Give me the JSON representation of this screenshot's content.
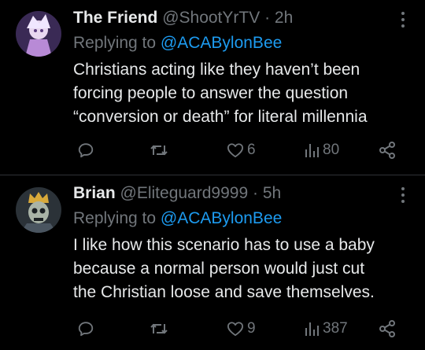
{
  "tweets": [
    {
      "display_name": "The Friend",
      "handle": "@ShootYrTV",
      "separator": "·",
      "time": "2h",
      "replying_to_prefix": "Replying to ",
      "replying_to_handle": "@ACABylonBee",
      "text_lines": [
        "Christians acting like they haven’t been",
        "forcing people to answer the question",
        "“conversion or death” for literal millennia"
      ],
      "likes": "6",
      "views": "80",
      "avatar_icon": "anime-character-avatar"
    },
    {
      "display_name": "Brian",
      "handle": "@Eliteguard9999",
      "separator": "·",
      "time": "5h",
      "replying_to_prefix": "Replying to ",
      "replying_to_handle": "@ACABylonBee",
      "text_lines": [
        "I like how this scenario has to use a baby",
        "because a normal person would just cut",
        "the Christian loose and save themselves."
      ],
      "likes": "9",
      "views": "387",
      "avatar_icon": "crowned-skeleton-avatar"
    }
  ],
  "icons": {
    "reply": "reply-icon",
    "retweet": "retweet-icon",
    "like": "heart-icon",
    "views": "views-chart-icon",
    "share": "share-icon",
    "more": "more-dots-icon"
  },
  "colors": {
    "background": "#000000",
    "text": "#e7e9ea",
    "secondary": "#71767b",
    "mention": "#1d9bf0",
    "divider": "#2f3336"
  }
}
